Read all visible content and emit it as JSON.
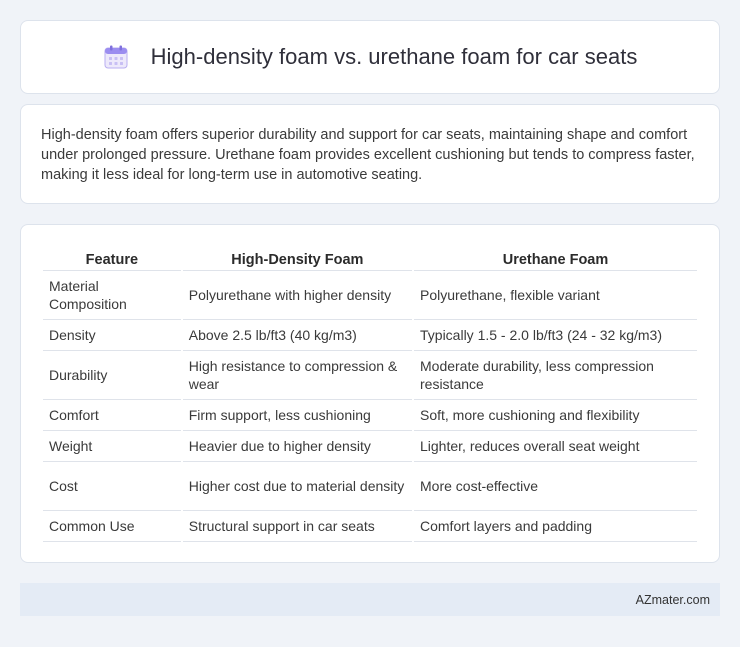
{
  "header": {
    "title": "High-density foam vs. urethane foam for car seats",
    "icon": "calendar-icon"
  },
  "summary": {
    "text": "High-density foam offers superior durability and support for car seats, maintaining shape and comfort under prolonged pressure. Urethane foam provides excellent cushioning but tends to compress faster, making it less ideal for long-term use in automotive seating."
  },
  "table": {
    "headers": [
      "Feature",
      "High-Density Foam",
      "Urethane Foam"
    ],
    "rows": [
      [
        "Material Composition",
        "Polyurethane with higher density",
        "Polyurethane, flexible variant"
      ],
      [
        "Density",
        "Above 2.5 lb/ft3 (40 kg/m3)",
        "Typically 1.5 - 2.0 lb/ft3 (24 - 32 kg/m3)"
      ],
      [
        "Durability",
        "High resistance to compression & wear",
        "Moderate durability, less compression resistance"
      ],
      [
        "Comfort",
        "Firm support, less cushioning",
        "Soft, more cushioning and flexibility"
      ],
      [
        "Weight",
        "Heavier due to higher density",
        "Lighter, reduces overall seat weight"
      ],
      [
        "Cost",
        "Higher cost due to material density",
        "More cost-effective"
      ],
      [
        "Common Use",
        "Structural support in car seats",
        "Comfort layers and padding"
      ]
    ]
  },
  "footer": {
    "text": "AZmater.com"
  },
  "colors": {
    "background": "#f0f3f8",
    "card": "#ffffff",
    "footer_bg": "#e4ebf5",
    "icon_accent": "#8a7be0"
  }
}
